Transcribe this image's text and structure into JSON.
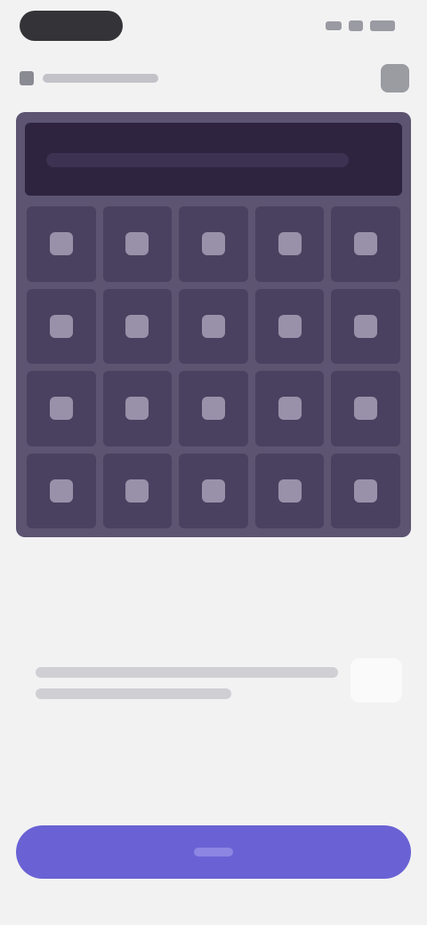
{
  "status_bar": {
    "icons": [
      "signal-icon",
      "wifi-icon",
      "battery-icon"
    ]
  },
  "header": {
    "back_icon": "chevron-left-icon",
    "menu_icon": "menu-icon"
  },
  "calculator": {
    "display_color": "#2e2440",
    "key_color": "#4a4160",
    "panel_color": "#5c5470",
    "rows": 4,
    "columns": 5
  },
  "primary_button": {
    "color": "#6a62d4"
  }
}
